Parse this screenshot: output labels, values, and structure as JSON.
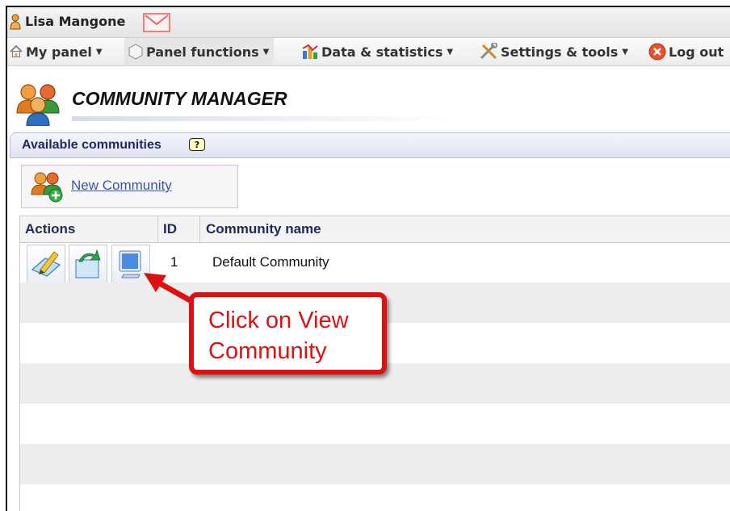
{
  "user": {
    "name": "Lisa Mangone"
  },
  "menu": [
    {
      "label": "My panel",
      "icon": "home-icon"
    },
    {
      "label": "Panel functions",
      "icon": "hexagon-icon"
    },
    {
      "label": "Data & statistics",
      "icon": "chart-icon"
    },
    {
      "label": "Settings & tools",
      "icon": "tools-icon"
    },
    {
      "label": "Log out",
      "icon": "logout-icon"
    }
  ],
  "page": {
    "title": "COMMUNITY MANAGER"
  },
  "panel": {
    "title": "Available communities",
    "help": "?"
  },
  "new_community": {
    "label": "New Community"
  },
  "table": {
    "columns": [
      "Actions",
      "ID",
      "Community name"
    ],
    "rows": [
      {
        "id": "1",
        "name": "Default Community",
        "actions": [
          "edit-icon",
          "reload-icon",
          "view-community-icon"
        ]
      }
    ]
  },
  "callout": {
    "line1": "Click on View",
    "line2": "Community"
  },
  "colors": {
    "accent": "#dd1111",
    "header_text": "#1d2a5a",
    "link": "#3a56a8"
  }
}
